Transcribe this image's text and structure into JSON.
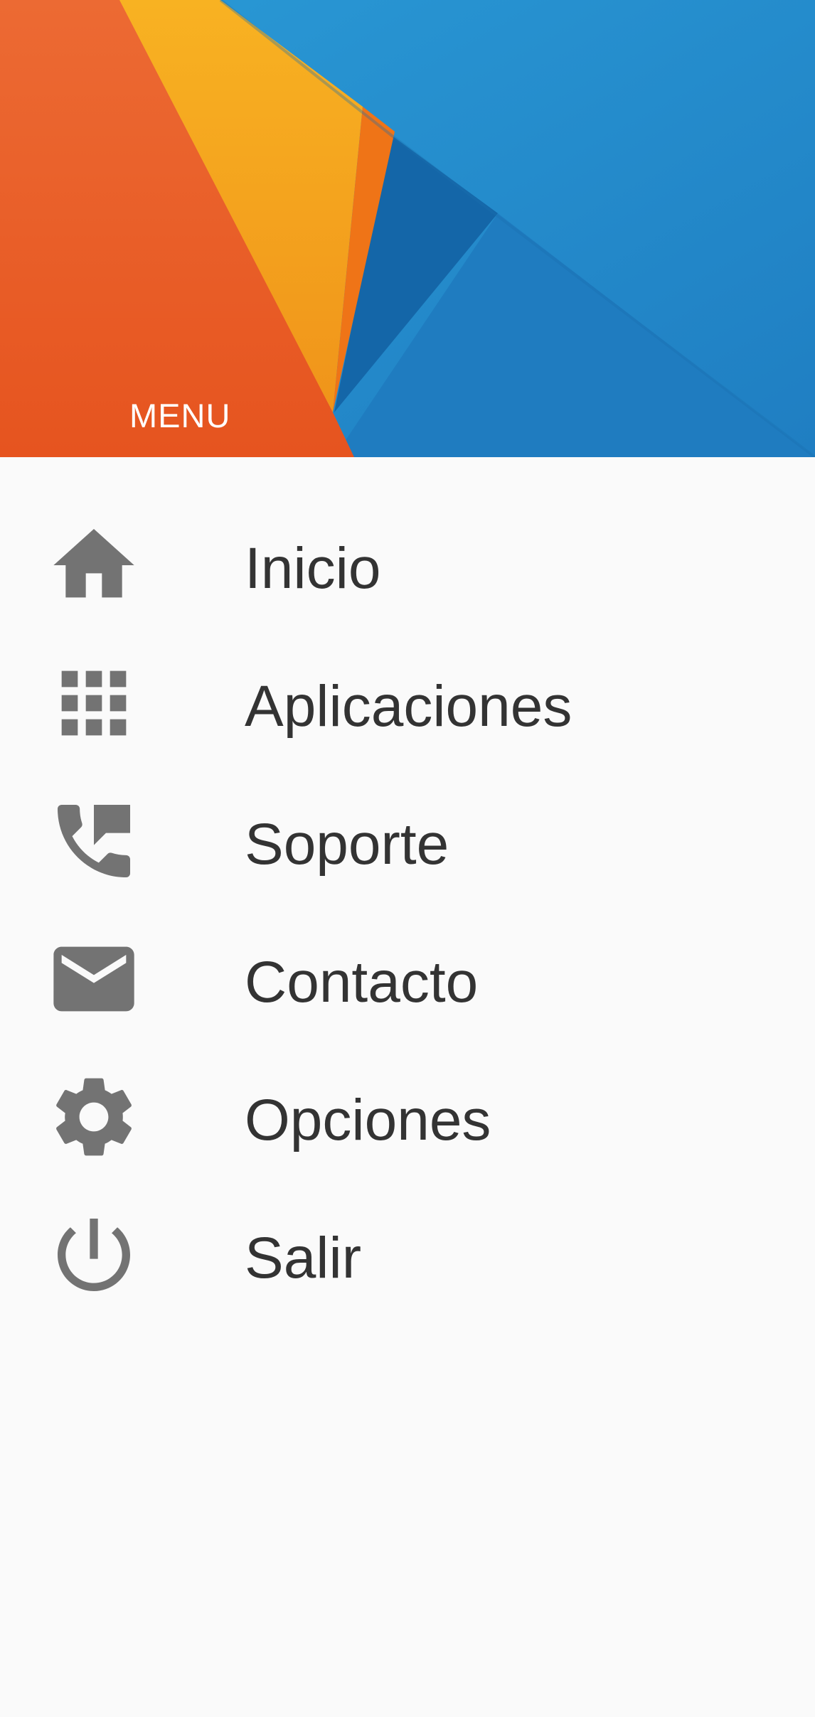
{
  "header": {
    "title": "MENU",
    "colors": {
      "orange": "#e95a24",
      "amber": "#f4a11c",
      "deep_orange": "#ef7417",
      "blue": "#2a93d0",
      "dark_blue": "#1466a8"
    }
  },
  "menu": {
    "icon_color": "#737373",
    "text_color": "#333333",
    "items": [
      {
        "label": "Inicio",
        "icon": "home-icon"
      },
      {
        "label": "Aplicaciones",
        "icon": "apps-grid-icon"
      },
      {
        "label": "Soporte",
        "icon": "phone-forward-icon"
      },
      {
        "label": "Contacto",
        "icon": "mail-icon"
      },
      {
        "label": "Opciones",
        "icon": "gear-icon"
      },
      {
        "label": "Salir",
        "icon": "power-icon"
      }
    ]
  }
}
